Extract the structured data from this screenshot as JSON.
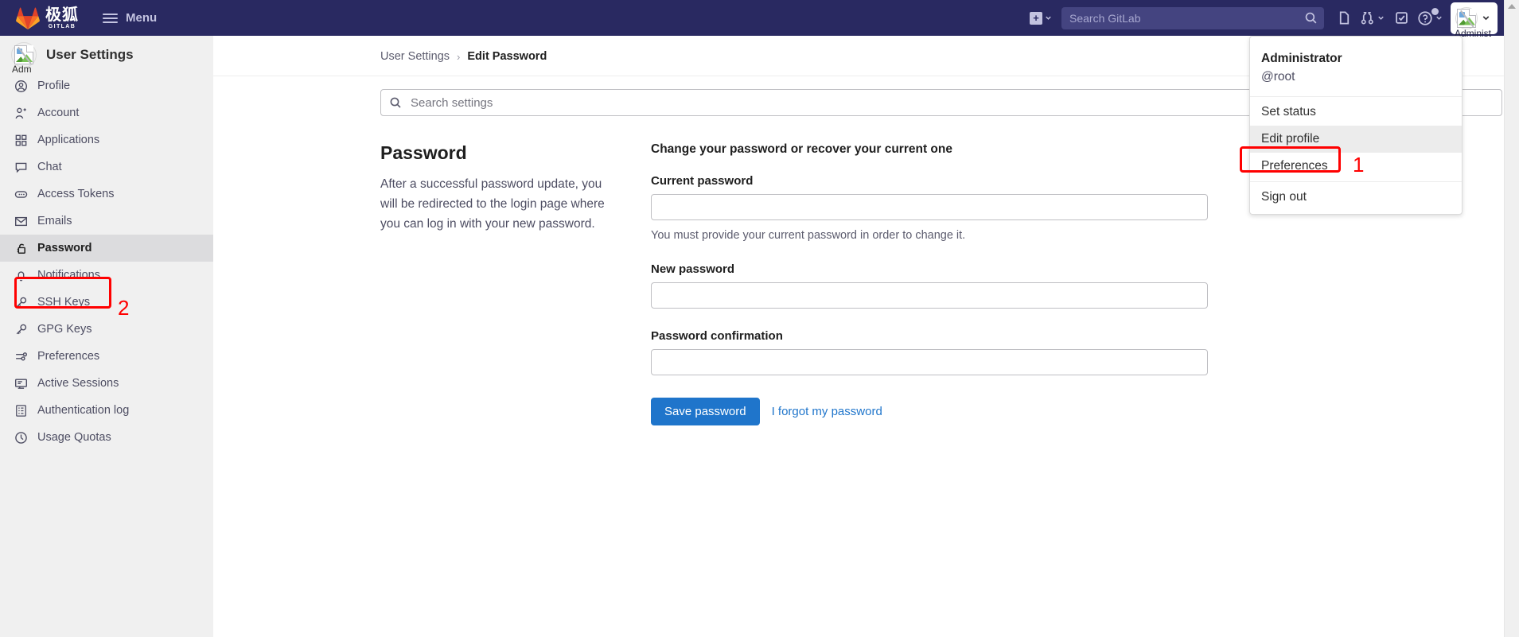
{
  "topnav": {
    "logo_cn": "极狐",
    "logo_sub": "GITLAB",
    "menu_label": "Menu",
    "new_icon": "plus-square-icon",
    "new_caret": "chevron-down-icon",
    "search_placeholder": "Search GitLab",
    "search_value": "",
    "search_icon": "search-icon",
    "issues_icon": "issues-icon",
    "merge_requests_icon": "merge-request-icon",
    "todos_icon": "todo-check-icon",
    "help_icon": "help-question-icon",
    "user_avatar_icon": "broken-image-avatar-icon",
    "user_avatar_alt": "Administ",
    "user_caret": "chevron-down-icon"
  },
  "user_dropdown": {
    "name": "Administrator",
    "username": "@root",
    "items": [
      {
        "label": "Set status",
        "highlighted": false
      },
      {
        "label": "Edit profile",
        "highlighted": true
      },
      {
        "label": "Preferences",
        "highlighted": false
      }
    ],
    "sign_out": "Sign out"
  },
  "sidebar": {
    "avatar_icon": "broken-image-avatar-icon",
    "avatar_alt": "Adm",
    "title": "User Settings",
    "items": [
      {
        "label": "Profile",
        "icon": "user-circle-icon",
        "active": false
      },
      {
        "label": "Account",
        "icon": "user-settings-icon",
        "active": false
      },
      {
        "label": "Applications",
        "icon": "applications-grid-icon",
        "active": false
      },
      {
        "label": "Chat",
        "icon": "chat-bubble-icon",
        "active": false
      },
      {
        "label": "Access Tokens",
        "icon": "token-icon",
        "active": false
      },
      {
        "label": "Emails",
        "icon": "envelope-icon",
        "active": false
      },
      {
        "label": "Password",
        "icon": "lock-icon",
        "active": true
      },
      {
        "label": "Notifications",
        "icon": "bell-icon",
        "active": false
      },
      {
        "label": "SSH Keys",
        "icon": "key-icon",
        "active": false
      },
      {
        "label": "GPG Keys",
        "icon": "key-icon",
        "active": false
      },
      {
        "label": "Preferences",
        "icon": "preferences-sliders-icon",
        "active": false
      },
      {
        "label": "Active Sessions",
        "icon": "monitor-icon",
        "active": false
      },
      {
        "label": "Authentication log",
        "icon": "log-list-icon",
        "active": false
      },
      {
        "label": "Usage Quotas",
        "icon": "quota-gauge-icon",
        "active": false
      }
    ]
  },
  "breadcrumb": {
    "root": "User Settings",
    "separator": "›",
    "current": "Edit Password"
  },
  "settings_search": {
    "placeholder": "Search settings",
    "value": "",
    "icon": "search-icon"
  },
  "main": {
    "heading": "Password",
    "description": "After a successful password update, you will be redirected to the login page where you can log in with your new password.",
    "form_legend": "Change your password or recover your current one",
    "fields": [
      {
        "label": "Current password",
        "value": "",
        "help": "You must provide your current password in order to change it."
      },
      {
        "label": "New password",
        "value": "",
        "help": ""
      },
      {
        "label": "Password confirmation",
        "value": "",
        "help": ""
      }
    ],
    "save_label": "Save password",
    "forgot_label": "I forgot my password"
  },
  "annotations": [
    {
      "number": "1",
      "target": "edit-profile-menu-item"
    },
    {
      "number": "2",
      "target": "sidebar-item-password"
    }
  ],
  "colors": {
    "nav_bg": "#292961",
    "primary_button": "#1f75cb",
    "link": "#1f75cb",
    "sidebar_bg": "#f0f0f0",
    "annotation": "#ff0000"
  }
}
